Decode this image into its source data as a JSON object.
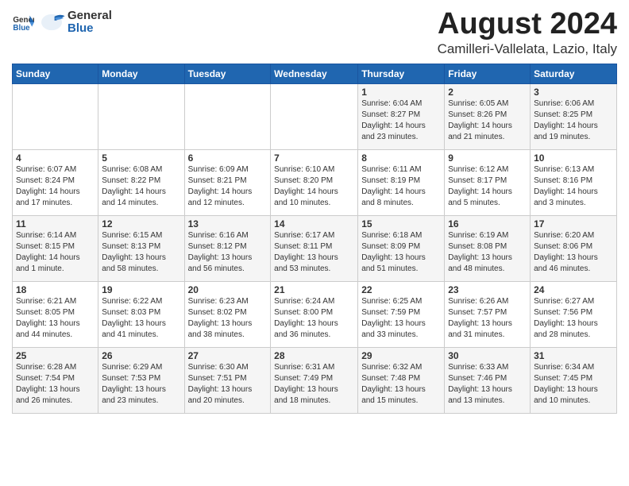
{
  "header": {
    "logo_general": "General",
    "logo_blue": "Blue",
    "month_title": "August 2024",
    "location": "Camilleri-Vallelata, Lazio, Italy"
  },
  "weekdays": [
    "Sunday",
    "Monday",
    "Tuesday",
    "Wednesday",
    "Thursday",
    "Friday",
    "Saturday"
  ],
  "weeks": [
    [
      {
        "day": "",
        "info": ""
      },
      {
        "day": "",
        "info": ""
      },
      {
        "day": "",
        "info": ""
      },
      {
        "day": "",
        "info": ""
      },
      {
        "day": "1",
        "info": "Sunrise: 6:04 AM\nSunset: 8:27 PM\nDaylight: 14 hours\nand 23 minutes."
      },
      {
        "day": "2",
        "info": "Sunrise: 6:05 AM\nSunset: 8:26 PM\nDaylight: 14 hours\nand 21 minutes."
      },
      {
        "day": "3",
        "info": "Sunrise: 6:06 AM\nSunset: 8:25 PM\nDaylight: 14 hours\nand 19 minutes."
      }
    ],
    [
      {
        "day": "4",
        "info": "Sunrise: 6:07 AM\nSunset: 8:24 PM\nDaylight: 14 hours\nand 17 minutes."
      },
      {
        "day": "5",
        "info": "Sunrise: 6:08 AM\nSunset: 8:22 PM\nDaylight: 14 hours\nand 14 minutes."
      },
      {
        "day": "6",
        "info": "Sunrise: 6:09 AM\nSunset: 8:21 PM\nDaylight: 14 hours\nand 12 minutes."
      },
      {
        "day": "7",
        "info": "Sunrise: 6:10 AM\nSunset: 8:20 PM\nDaylight: 14 hours\nand 10 minutes."
      },
      {
        "day": "8",
        "info": "Sunrise: 6:11 AM\nSunset: 8:19 PM\nDaylight: 14 hours\nand 8 minutes."
      },
      {
        "day": "9",
        "info": "Sunrise: 6:12 AM\nSunset: 8:17 PM\nDaylight: 14 hours\nand 5 minutes."
      },
      {
        "day": "10",
        "info": "Sunrise: 6:13 AM\nSunset: 8:16 PM\nDaylight: 14 hours\nand 3 minutes."
      }
    ],
    [
      {
        "day": "11",
        "info": "Sunrise: 6:14 AM\nSunset: 8:15 PM\nDaylight: 14 hours\nand 1 minute."
      },
      {
        "day": "12",
        "info": "Sunrise: 6:15 AM\nSunset: 8:13 PM\nDaylight: 13 hours\nand 58 minutes."
      },
      {
        "day": "13",
        "info": "Sunrise: 6:16 AM\nSunset: 8:12 PM\nDaylight: 13 hours\nand 56 minutes."
      },
      {
        "day": "14",
        "info": "Sunrise: 6:17 AM\nSunset: 8:11 PM\nDaylight: 13 hours\nand 53 minutes."
      },
      {
        "day": "15",
        "info": "Sunrise: 6:18 AM\nSunset: 8:09 PM\nDaylight: 13 hours\nand 51 minutes."
      },
      {
        "day": "16",
        "info": "Sunrise: 6:19 AM\nSunset: 8:08 PM\nDaylight: 13 hours\nand 48 minutes."
      },
      {
        "day": "17",
        "info": "Sunrise: 6:20 AM\nSunset: 8:06 PM\nDaylight: 13 hours\nand 46 minutes."
      }
    ],
    [
      {
        "day": "18",
        "info": "Sunrise: 6:21 AM\nSunset: 8:05 PM\nDaylight: 13 hours\nand 44 minutes."
      },
      {
        "day": "19",
        "info": "Sunrise: 6:22 AM\nSunset: 8:03 PM\nDaylight: 13 hours\nand 41 minutes."
      },
      {
        "day": "20",
        "info": "Sunrise: 6:23 AM\nSunset: 8:02 PM\nDaylight: 13 hours\nand 38 minutes."
      },
      {
        "day": "21",
        "info": "Sunrise: 6:24 AM\nSunset: 8:00 PM\nDaylight: 13 hours\nand 36 minutes."
      },
      {
        "day": "22",
        "info": "Sunrise: 6:25 AM\nSunset: 7:59 PM\nDaylight: 13 hours\nand 33 minutes."
      },
      {
        "day": "23",
        "info": "Sunrise: 6:26 AM\nSunset: 7:57 PM\nDaylight: 13 hours\nand 31 minutes."
      },
      {
        "day": "24",
        "info": "Sunrise: 6:27 AM\nSunset: 7:56 PM\nDaylight: 13 hours\nand 28 minutes."
      }
    ],
    [
      {
        "day": "25",
        "info": "Sunrise: 6:28 AM\nSunset: 7:54 PM\nDaylight: 13 hours\nand 26 minutes."
      },
      {
        "day": "26",
        "info": "Sunrise: 6:29 AM\nSunset: 7:53 PM\nDaylight: 13 hours\nand 23 minutes."
      },
      {
        "day": "27",
        "info": "Sunrise: 6:30 AM\nSunset: 7:51 PM\nDaylight: 13 hours\nand 20 minutes."
      },
      {
        "day": "28",
        "info": "Sunrise: 6:31 AM\nSunset: 7:49 PM\nDaylight: 13 hours\nand 18 minutes."
      },
      {
        "day": "29",
        "info": "Sunrise: 6:32 AM\nSunset: 7:48 PM\nDaylight: 13 hours\nand 15 minutes."
      },
      {
        "day": "30",
        "info": "Sunrise: 6:33 AM\nSunset: 7:46 PM\nDaylight: 13 hours\nand 13 minutes."
      },
      {
        "day": "31",
        "info": "Sunrise: 6:34 AM\nSunset: 7:45 PM\nDaylight: 13 hours\nand 10 minutes."
      }
    ]
  ]
}
